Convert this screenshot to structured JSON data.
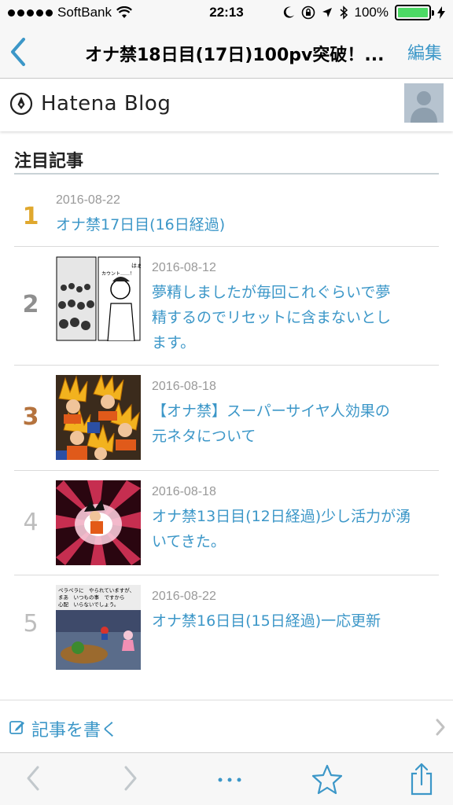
{
  "status_bar": {
    "carrier": "SoftBank",
    "time": "22:13",
    "battery": "100%"
  },
  "nav": {
    "title": "オナ禁18日目(17日)100pv突破！...",
    "edit_label": "編集",
    "back_icon": "chevron-left-icon"
  },
  "blog": {
    "brand": "Hatena Blog"
  },
  "section": {
    "title": "注目記事"
  },
  "entries": [
    {
      "rank": "1",
      "date": "2016-08-22",
      "title_lines": [
        "オナ禁17日目(16日経過)"
      ],
      "rank_color": "#e0a82e"
    },
    {
      "rank": "2",
      "date": "2016-08-12",
      "title_lines": [
        "夢精しましたが毎回これぐらいで夢",
        "精するのでリセットに含まないとし",
        "ます。"
      ],
      "rank_color": "#8f8f8f"
    },
    {
      "rank": "3",
      "date": "2016-08-18",
      "title_lines": [
        "【オナ禁】スーパーサイヤ人効果の",
        "元ネタについて"
      ],
      "rank_color": "#b5733e"
    },
    {
      "rank": "4",
      "date": "2016-08-18",
      "title_lines": [
        "オナ禁13日目(12日経過)少し活力が湧",
        "いてきた。"
      ],
      "rank_color": "#bdbdbd"
    },
    {
      "rank": "5",
      "date": "2016-08-22",
      "title_lines": [
        "オナ禁16日目(15日経過)一応更新"
      ],
      "rank_color": "#bdbdbd"
    }
  ],
  "thumb_text": {
    "manga_1": "はぁ……",
    "manga_2": "カウント……！",
    "game_1": "ペラペラに　やられていますが、",
    "game_2": "まあ　いつもの事　ですから",
    "game_3": "心配　いらないでしょう。"
  },
  "write": {
    "label": "記事を書く"
  },
  "toolbar": {
    "back_icon": "chevron-left-icon",
    "forward_icon": "chevron-right-icon",
    "more_icon": "more-dots-icon",
    "bookmark_icon": "star-icon",
    "share_icon": "share-icon"
  },
  "colors": {
    "accent": "#3c97c8",
    "battery": "#4cd964"
  }
}
